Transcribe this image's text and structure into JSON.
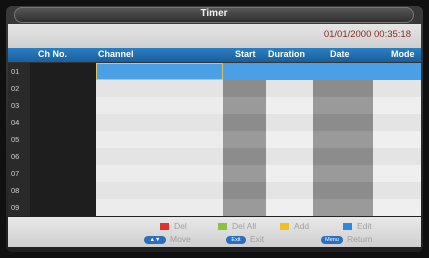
{
  "title": "Timer",
  "datetime": "01/01/2000 00:35:18",
  "columns": {
    "chno": "Ch No.",
    "channel": "Channel",
    "start": "Start",
    "duration": "Duration",
    "date": "Date",
    "mode": "Mode"
  },
  "rows": [
    "01",
    "02",
    "03",
    "04",
    "05",
    "06",
    "07",
    "08",
    "09"
  ],
  "selected_row": "01",
  "colors": {
    "header": "#2a7fc4",
    "selection": "#4aa0e6"
  },
  "legend": {
    "del": {
      "label": "Del",
      "color": "#e03030"
    },
    "del_all": {
      "label": "Del All",
      "color": "#8cc040"
    },
    "add": {
      "label": "Add",
      "color": "#f0c020"
    },
    "edit": {
      "label": "Edit",
      "color": "#2a8ae0"
    }
  },
  "keys": {
    "move": {
      "key": "▲▼",
      "label": "Move"
    },
    "exit": {
      "key": "Exit",
      "label": "Exit"
    },
    "return": {
      "key": "Menu",
      "label": "Return"
    }
  }
}
